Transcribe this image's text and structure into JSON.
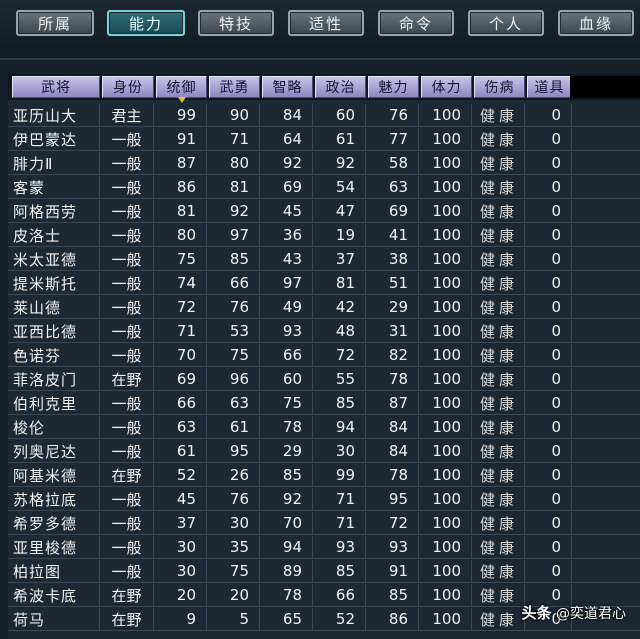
{
  "tabs": [
    {
      "label": "所属",
      "active": false
    },
    {
      "label": "能力",
      "active": true
    },
    {
      "label": "特技",
      "active": false
    },
    {
      "label": "适性",
      "active": false
    },
    {
      "label": "命令",
      "active": false
    },
    {
      "label": "个人",
      "active": false
    },
    {
      "label": "血缘",
      "active": false
    }
  ],
  "table": {
    "headers": [
      "武将",
      "身份",
      "统御",
      "武勇",
      "智略",
      "政治",
      "魅力",
      "体力",
      "伤病",
      "道具"
    ],
    "sorted_column": "统御",
    "rows": [
      [
        "亚历山大",
        "君主",
        "99",
        "90",
        "84",
        "60",
        "76",
        "100",
        "健康",
        "0"
      ],
      [
        "伊巴蒙达",
        "一般",
        "91",
        "71",
        "64",
        "61",
        "77",
        "100",
        "健康",
        "0"
      ],
      [
        "腓力Ⅱ",
        "一般",
        "87",
        "80",
        "92",
        "92",
        "58",
        "100",
        "健康",
        "0"
      ],
      [
        "客蒙",
        "一般",
        "86",
        "81",
        "69",
        "54",
        "63",
        "100",
        "健康",
        "0"
      ],
      [
        "阿格西劳",
        "一般",
        "81",
        "92",
        "45",
        "47",
        "69",
        "100",
        "健康",
        "0"
      ],
      [
        "皮洛士",
        "一般",
        "80",
        "97",
        "36",
        "19",
        "41",
        "100",
        "健康",
        "0"
      ],
      [
        "米太亚德",
        "一般",
        "75",
        "85",
        "43",
        "37",
        "38",
        "100",
        "健康",
        "0"
      ],
      [
        "提米斯托",
        "一般",
        "74",
        "66",
        "97",
        "81",
        "51",
        "100",
        "健康",
        "0"
      ],
      [
        "莱山德",
        "一般",
        "72",
        "76",
        "49",
        "42",
        "29",
        "100",
        "健康",
        "0"
      ],
      [
        "亚西比德",
        "一般",
        "71",
        "53",
        "93",
        "48",
        "31",
        "100",
        "健康",
        "0"
      ],
      [
        "色诺芬",
        "一般",
        "70",
        "75",
        "66",
        "72",
        "82",
        "100",
        "健康",
        "0"
      ],
      [
        "菲洛皮门",
        "在野",
        "69",
        "96",
        "60",
        "55",
        "78",
        "100",
        "健康",
        "0"
      ],
      [
        "伯利克里",
        "一般",
        "66",
        "63",
        "75",
        "85",
        "87",
        "100",
        "健康",
        "0"
      ],
      [
        "梭伦",
        "一般",
        "63",
        "61",
        "78",
        "94",
        "84",
        "100",
        "健康",
        "0"
      ],
      [
        "列奥尼达",
        "一般",
        "61",
        "95",
        "29",
        "30",
        "84",
        "100",
        "健康",
        "0"
      ],
      [
        "阿基米德",
        "在野",
        "52",
        "26",
        "85",
        "99",
        "78",
        "100",
        "健康",
        "0"
      ],
      [
        "苏格拉底",
        "一般",
        "45",
        "76",
        "92",
        "71",
        "95",
        "100",
        "健康",
        "0"
      ],
      [
        "希罗多德",
        "一般",
        "37",
        "30",
        "70",
        "71",
        "72",
        "100",
        "健康",
        "0"
      ],
      [
        "亚里梭德",
        "一般",
        "30",
        "35",
        "94",
        "93",
        "93",
        "100",
        "健康",
        "0"
      ],
      [
        "柏拉图",
        "一般",
        "30",
        "75",
        "89",
        "85",
        "91",
        "100",
        "健康",
        "0"
      ],
      [
        "希波卡底",
        "在野",
        "20",
        "20",
        "78",
        "66",
        "85",
        "100",
        "健康",
        "0"
      ],
      [
        "荷马",
        "在野",
        "9",
        "5",
        "65",
        "52",
        "86",
        "100",
        "健康",
        "0"
      ]
    ]
  },
  "watermark": {
    "brand": "头条",
    "handle": "@奕道君心"
  }
}
